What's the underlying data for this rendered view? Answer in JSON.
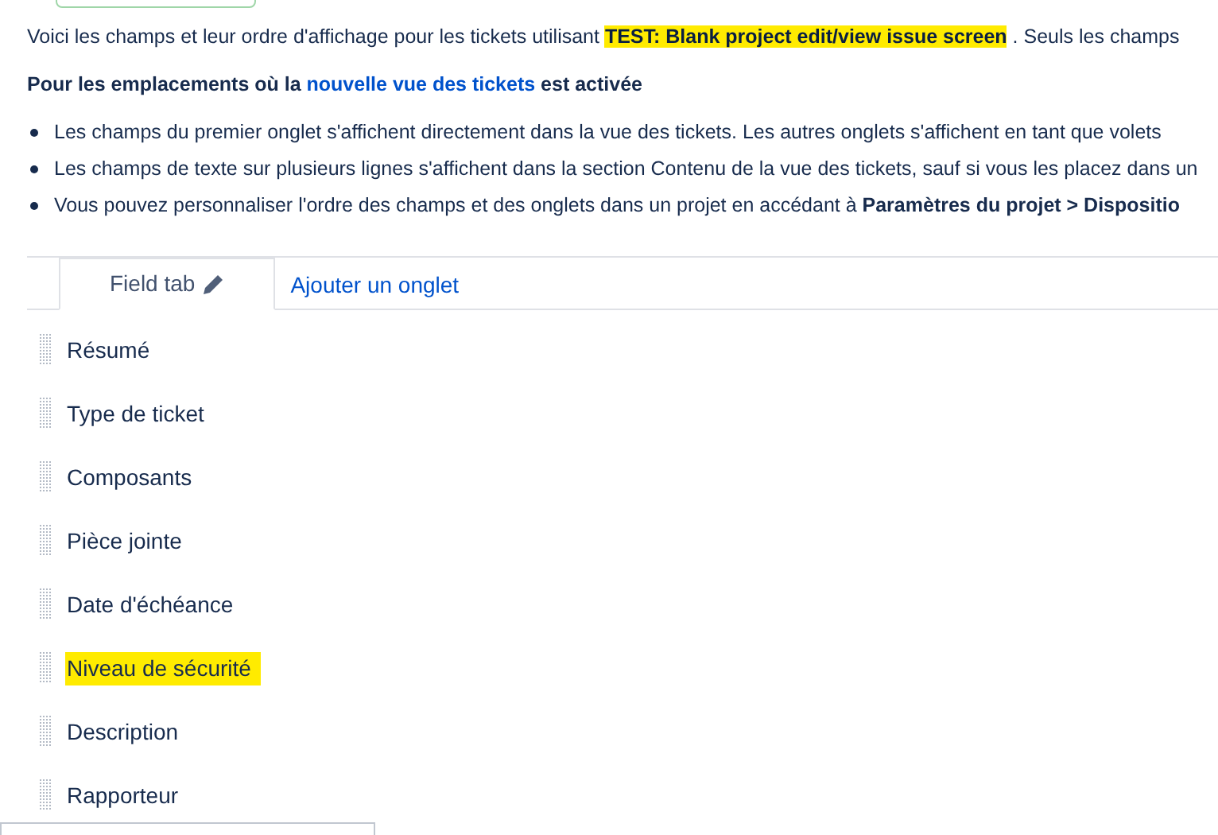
{
  "intro": {
    "before": "Voici les champs et leur ordre d'affichage pour les tickets utilisant",
    "screen_name": "TEST: Blank project edit/view issue screen",
    "screen_name_highlighted": true,
    "after": ". Seuls les champs"
  },
  "heading": {
    "before": "Pour les emplacements où la",
    "link": "nouvelle vue des tickets",
    "after": "est activée"
  },
  "bullets": [
    "Les champs du premier onglet s'affichent directement dans la vue des tickets. Les autres onglets s'affichent en tant que volets",
    "Les champs de texte sur plusieurs lignes s'affichent dans la section Contenu de la vue des tickets, sauf si vous les placez dans un",
    "Vous pouvez personnaliser l'ordre des champs et des onglets dans un projet en accédant à **Paramètres du projet > Dispositio**"
  ],
  "tabs": [
    {
      "kind": "tab",
      "label": "Field tab",
      "selected": true
    },
    {
      "kind": "add",
      "label": "Ajouter un onglet",
      "selected": false
    }
  ],
  "fields": [
    {
      "label": "Résumé",
      "highlighted": false
    },
    {
      "label": "Type de ticket",
      "highlighted": false
    },
    {
      "label": "Composants",
      "highlighted": false
    },
    {
      "label": "Pièce jointe",
      "highlighted": false
    },
    {
      "label": "Date d'échéance",
      "highlighted": false
    },
    {
      "label": "Niveau de sécurité",
      "highlighted": true
    },
    {
      "label": "Description",
      "highlighted": false
    },
    {
      "label": "Rapporteur",
      "highlighted": false
    }
  ]
}
